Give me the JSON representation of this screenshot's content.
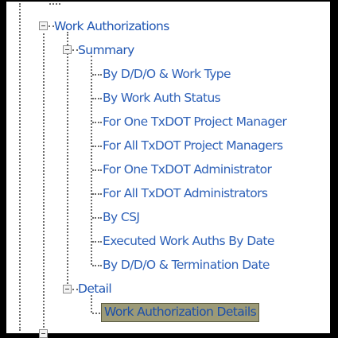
{
  "tree": {
    "root": {
      "label": "Work Authorizations",
      "expanded": true,
      "icon": "minus-box-icon"
    },
    "summary": {
      "label": "Summary",
      "expanded": true,
      "icon": "minus-box-icon",
      "items": [
        "By D/D/O & Work Type",
        "By Work Auth Status",
        "For One TxDOT Project Manager",
        "For All TxDOT Project Managers",
        "For One TxDOT Administrator",
        "For All TxDOT Administrators",
        "By CSJ",
        "Executed Work Auths By Date",
        "By D/D/O & Termination Date"
      ]
    },
    "detail": {
      "label": "Detail",
      "expanded": true,
      "icon": "minus-box-icon",
      "items": [
        "Work Authorization Details"
      ],
      "selected_item": "Work Authorization Details"
    }
  },
  "colors": {
    "link_text": "#2e61b8",
    "selection_bg": "#9c9a77",
    "frame": "#000000",
    "guide_lines": "#6a6a6a"
  }
}
